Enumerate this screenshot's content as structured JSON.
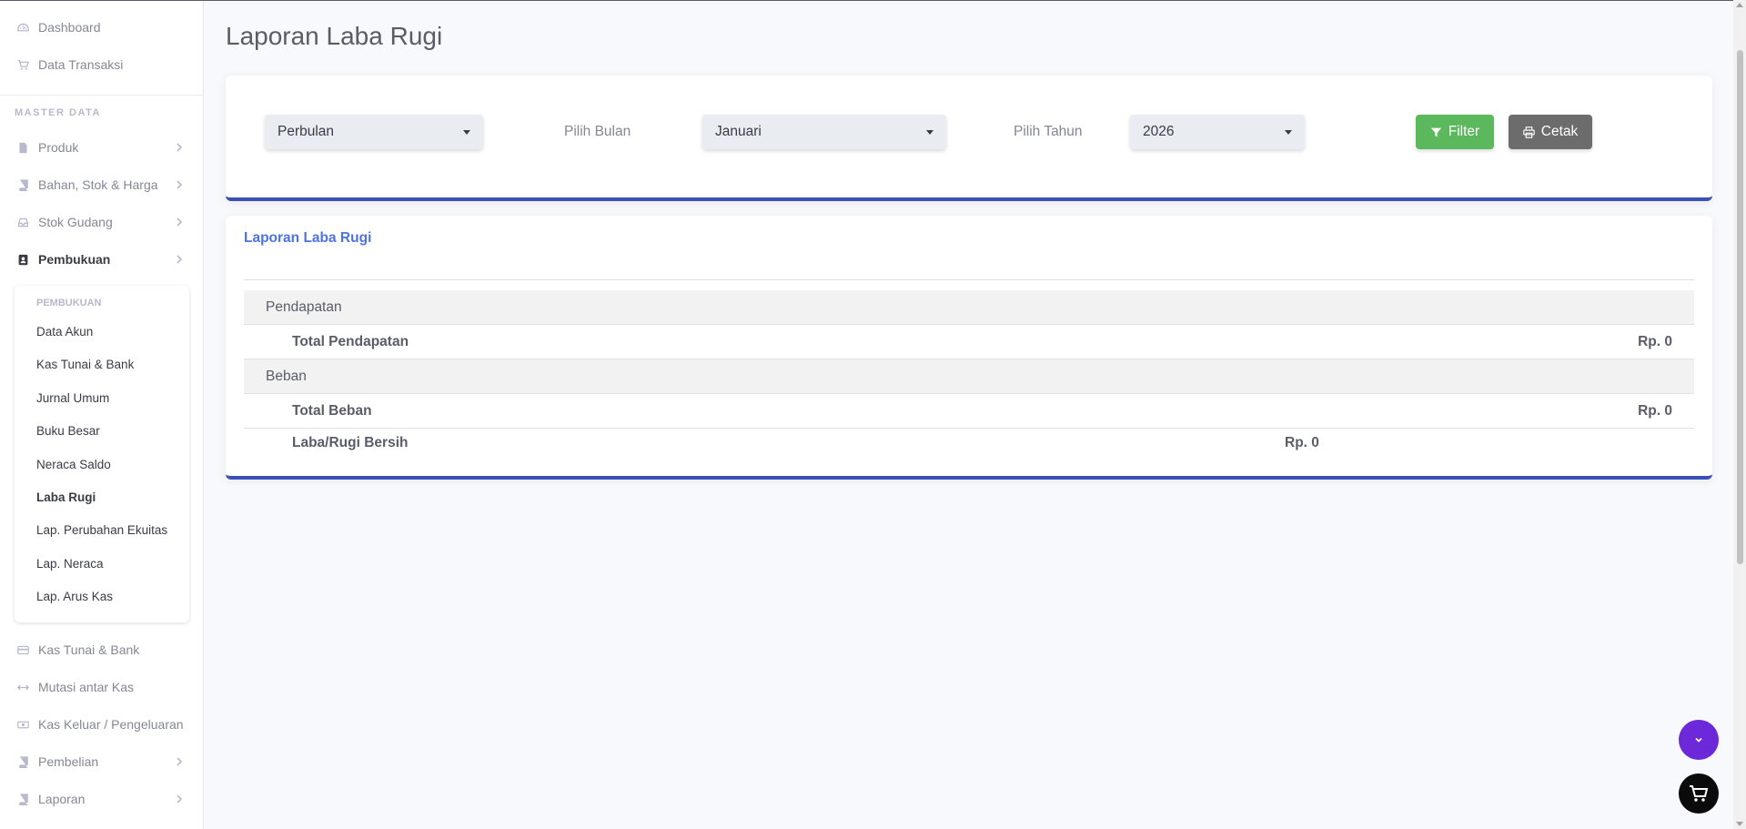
{
  "sidebar": {
    "items": [
      {
        "label": "Dashboard",
        "icon": "dashboard-icon"
      },
      {
        "label": "Data Transaksi",
        "icon": "cart-icon"
      }
    ],
    "master_heading": "MASTER DATA",
    "master_items": [
      {
        "label": "Produk",
        "icon": "file-icon"
      },
      {
        "label": "Bahan, Stok & Harga",
        "icon": "book-icon"
      },
      {
        "label": "Stok Gudang",
        "icon": "inbox-icon"
      },
      {
        "label": "Pembukuan",
        "icon": "address-book-icon"
      }
    ],
    "submenu": {
      "header": "PEMBUKUAN",
      "items": [
        "Data Akun",
        "Kas Tunai & Bank",
        "Jurnal Umum",
        "Buku Besar",
        "Neraca Saldo",
        "Laba Rugi",
        "Lap. Perubahan Ekuitas",
        "Lap. Neraca",
        "Lap. Arus Kas"
      ],
      "active": "Laba Rugi"
    },
    "lower_items": [
      {
        "label": "Kas Tunai & Bank",
        "icon": "credit-card-icon"
      },
      {
        "label": "Mutasi antar Kas",
        "icon": "arrows-h-icon"
      },
      {
        "label": "Kas Keluar / Pengeluaran",
        "icon": "money-icon"
      },
      {
        "label": "Pembelian",
        "icon": "book-icon"
      },
      {
        "label": "Laporan",
        "icon": "book-icon"
      }
    ]
  },
  "page": {
    "title": "Laporan Laba Rugi"
  },
  "filter": {
    "period_select": "Perbulan",
    "month_label": "Pilih Bulan",
    "month_select": "Januari",
    "year_label": "Pilih Tahun",
    "year_select": "2026",
    "filter_button": "Filter",
    "print_button": "Cetak"
  },
  "report": {
    "title": "Laporan Laba Rugi",
    "income_heading": "Pendapatan",
    "income_total_label": "Total Pendapatan",
    "income_total_value": "Rp. 0",
    "expense_heading": "Beban",
    "expense_total_label": "Total Beban",
    "expense_total_value": "Rp. 0",
    "net_label": "Laba/Rugi Bersih",
    "net_value": "Rp. 0"
  },
  "colors": {
    "accent": "#3a4fb8",
    "link": "#4e73df",
    "filter_button": "#5cb85c",
    "print_button": "#6c6c6c",
    "fab_scroll": "#6d28d9",
    "fab_cart": "#0b0b0b"
  }
}
